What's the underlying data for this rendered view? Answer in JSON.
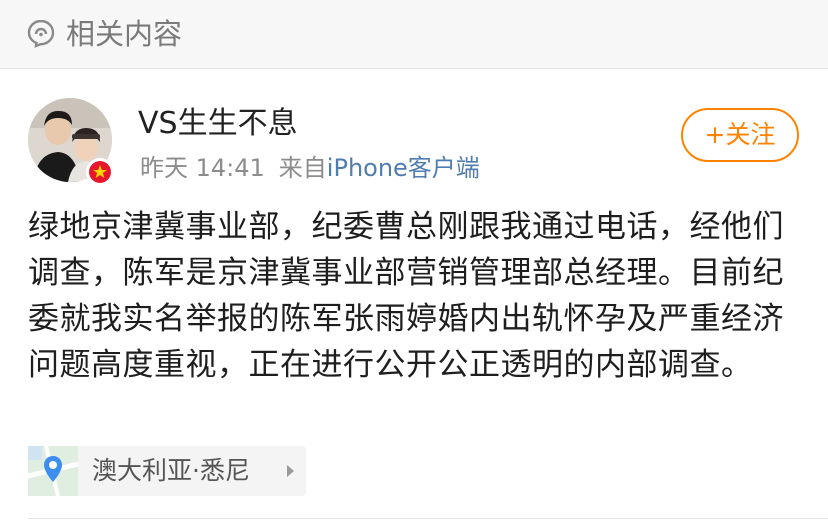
{
  "header": {
    "title": "相关内容",
    "icon": "related-content-icon"
  },
  "post": {
    "username": "VS生生不息",
    "time": "昨天 14:41",
    "source_prefix": "来自",
    "source_device": "iPhone客户端",
    "follow_label": "+关注",
    "content": "绿地京津冀事业部，纪委曹总刚跟我通过电话，经他们调查，陈军是京津冀事业部营销管理部总经理。目前纪委就我实名举报的陈军张雨婷婚内出轨怀孕及严重经济问题高度重视，正在进行公开公正透明的内部调查。",
    "location": "澳大利亚·悉尼"
  },
  "colors": {
    "accent": "#ff8200",
    "link": "#507daf",
    "badge": "#e6162d"
  }
}
